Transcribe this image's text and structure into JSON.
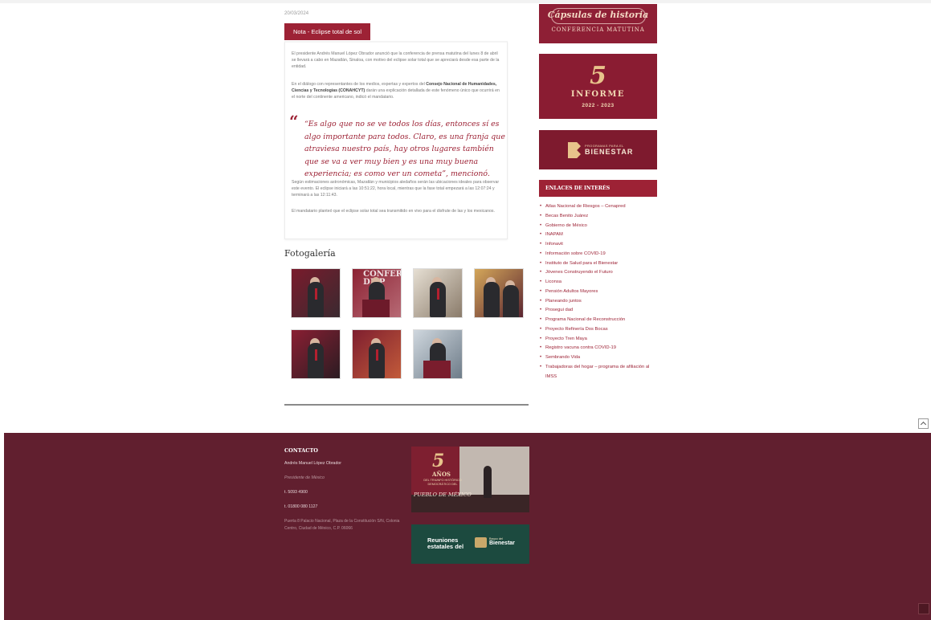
{
  "article": {
    "date": "20/03/2024",
    "note_tab": "Nota - Eclipse total de sol",
    "p1": "El presidente Andrés Manuel López Obrador anunció que la conferencia de prensa matutina del lunes 8 de abril se llevará a cabo en Mazatlán, Sinaloa, con motivo del eclipse solar total que se apreciará desde esa parte de la entidad.",
    "p2_a": "En el diálogo con representantes de los medios, expertas y expertos del ",
    "p2_b": "Consejo Nacional de Humanidades, Ciencias y Tecnologías (CONAHCYT)",
    "p2_c": " darán una explicación detallada de este fenómeno único que ocurrirá en el norte del continente americano, indicó el mandatario.",
    "quote_mark": "“",
    "quote": "“Es algo que no se ve todos los días, entonces sí es algo importante para todos. Claro, es una franja que atraviesa nuestro país, hay otros lugares también que se va a ver muy bien y es una muy buena experiencia; es como ver un cometa”, mencionó.",
    "p3": "Según estimaciones astronómicas, Mazatlán y municipios aledaños serán las ubicaciones ideales para observar este evento. El eclipse iniciará a las 10:51:22, hora local, mientras que la fase total empezará a las 12:07:24 y terminará a las 12:11:43.",
    "p4": "El mandatario planteó que el eclipse solar total sea transmitido en vivo para el disfrute de las y los mexicanos."
  },
  "gallery": {
    "title": "Fotogalería",
    "thumb_text": "CONFER\nDE P"
  },
  "sidebar": {
    "banner1_title": "Cápsulas de historia",
    "banner1_sub": "CONFERENCIA MATUTINA",
    "banner2_num": "5",
    "banner2_title": "INFORME",
    "banner2_years": "2022 - 2023",
    "banner3_small": "PROGRAMAS PARA EL",
    "banner3_big": "BIENESTAR",
    "links_title": "ENLACES DE INTERÉS",
    "links": [
      "Atlas Nacional de Riesgos – Cenapred",
      "Becas Benito Juárez",
      "Gobierno de México",
      "INAPAM",
      "Infonavit",
      "Información sobre COVID-19",
      "Instituto de Salud para el Bienestar",
      "Jóvenes Construyendo el Futuro",
      "Liconsa",
      "Pensión Adultos Mayores",
      "Planeando juntos",
      "Prosegui dad",
      "Programa Nacional de Reconstrucción",
      "Proyecto Refinería Dos Bocas",
      "Proyecto Tren Maya",
      "Registro vacuna contra COVID-19",
      "Sembrando Vida",
      "Trabajadoras del hogar – programa de afiliación al IMSS"
    ]
  },
  "footer": {
    "contact_title": "CONTACTO",
    "name": "Andrés Manuel López Obrador",
    "role": "Presidente de México",
    "phone1": "t. 5093 4900",
    "phone2": "t. 01800 080 1127",
    "address": "Puerta 8 Palacio Nacional, Plaza de la Constitución S/N, Colonia Centro, Ciudad de México, C.P. 06066",
    "img1_num": "5",
    "img1_anos": "AÑOS",
    "img1_sub": "DEL TRIUNFO HISTÓRICO DEMOCRÁTICO DEL",
    "img1_pueblo": "PUEBLO DE MÉXICO",
    "img2_title": "Reuniones\nestatales del",
    "img2_small": "Banco del",
    "img2_big": "Bienestar"
  },
  "colors": {
    "accent": "#9d2235",
    "footer_bg": "#611f2f"
  }
}
